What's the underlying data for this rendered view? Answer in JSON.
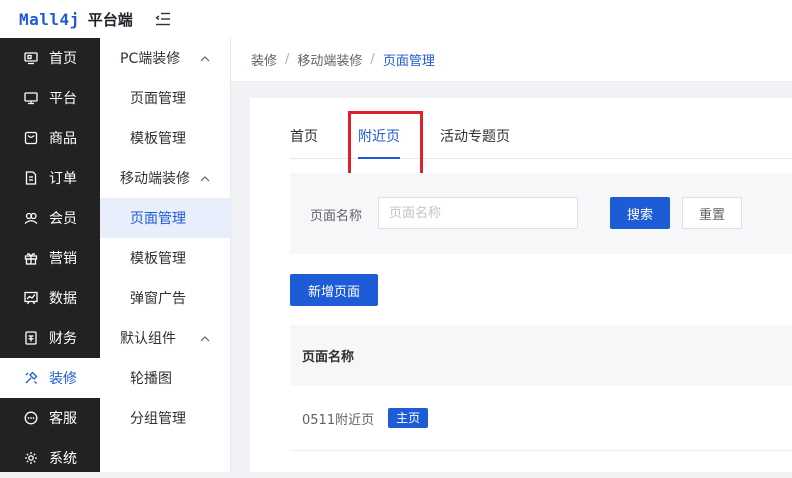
{
  "header": {
    "logo_mark": "Mall4j",
    "logo_text": "平台端"
  },
  "sidebar": {
    "items": [
      {
        "label": "首页"
      },
      {
        "label": "平台"
      },
      {
        "label": "商品"
      },
      {
        "label": "订单"
      },
      {
        "label": "会员"
      },
      {
        "label": "营销"
      },
      {
        "label": "数据"
      },
      {
        "label": "财务"
      },
      {
        "label": "装修"
      },
      {
        "label": "客服"
      },
      {
        "label": "系统"
      }
    ]
  },
  "submenu": {
    "groups": [
      {
        "label": "PC端装修",
        "items": [
          "页面管理",
          "模板管理"
        ]
      },
      {
        "label": "移动端装修",
        "items": [
          "页面管理",
          "模板管理",
          "弹窗广告"
        ]
      },
      {
        "label": "默认组件",
        "items": [
          "轮播图",
          "分组管理"
        ]
      }
    ]
  },
  "breadcrumb": [
    "装修",
    "移动端装修",
    "页面管理"
  ],
  "tabs": [
    "首页",
    "附近页",
    "活动专题页"
  ],
  "search": {
    "label": "页面名称",
    "placeholder": "页面名称",
    "value": "",
    "search_label": "搜索",
    "reset_label": "重置"
  },
  "add_button": "新增页面",
  "table": {
    "header": "页面名称",
    "rows": [
      {
        "name": "0511附近页",
        "badge": "主页"
      }
    ]
  },
  "colors": {
    "accent": "#1e5bd6",
    "sidebar_bg": "#222222",
    "highlight": "#e0202a"
  }
}
